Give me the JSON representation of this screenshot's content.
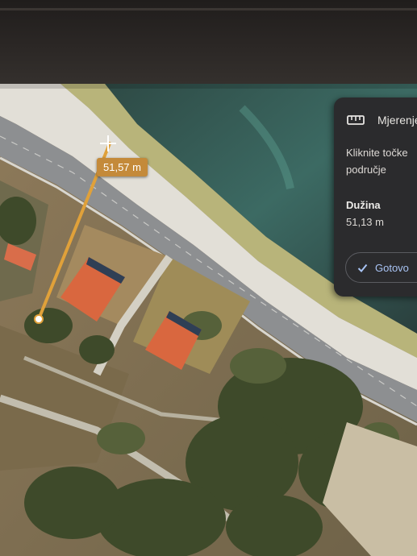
{
  "map": {
    "measure_label": "51,57 m",
    "crosshair_icon": "crosshair-icon",
    "colors": {
      "label_bg": "#c48a3a",
      "measure_line": "#e0a13a",
      "roof": "#d9673f"
    }
  },
  "measure_panel": {
    "icon": "ruler-icon",
    "title": "Mjerenje",
    "hint": "Kliknite točke područje",
    "length_label": "Dužina",
    "length_value": "51,13 m",
    "done_button": "Gotovo",
    "done_icon": "check-icon",
    "colors": {
      "bg": "#2b2b2d",
      "button_text": "#a9c4f5"
    }
  }
}
